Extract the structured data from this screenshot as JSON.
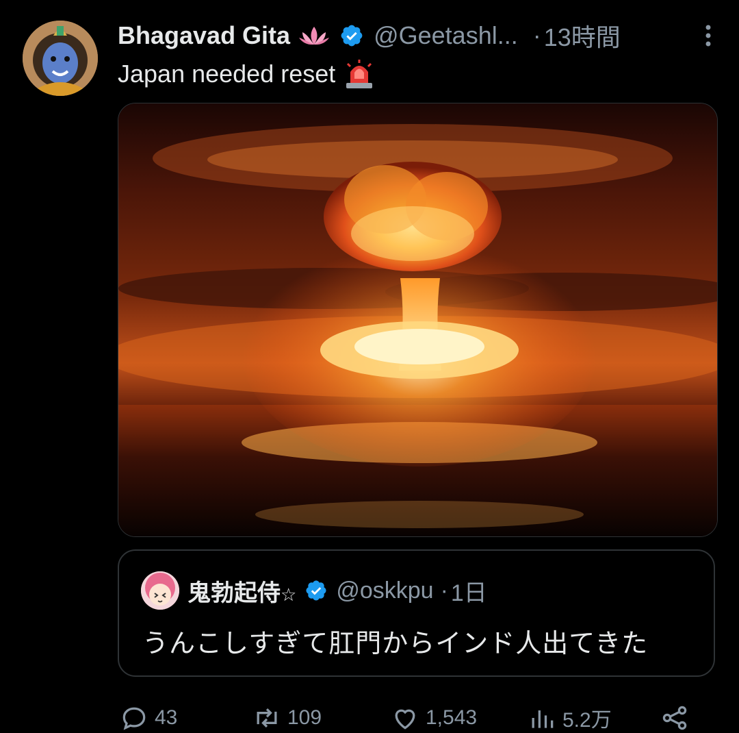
{
  "tweet": {
    "author_name": "Bhagavad Gita",
    "handle": "@Geetashl...",
    "separator": "·",
    "time": "13時間",
    "text": "Japan needed reset",
    "icons": {
      "lotus": "lotus-emoji-icon",
      "verified": "verified-badge-icon",
      "siren": "rotating-light-emoji-icon",
      "more": "more-options-icon"
    }
  },
  "quote": {
    "author_name": "鬼勃起侍",
    "star": "☆",
    "handle": "@oskkpu",
    "separator": "·",
    "time": "1日",
    "text": "うんこしすぎて肛門からインド人出てきた"
  },
  "actions": {
    "replies": "43",
    "retweets": "109",
    "likes": "1,543",
    "views": "5.2万"
  },
  "colors": {
    "background": "#000000",
    "text": "#e7e9ea",
    "secondary": "#8b98a5",
    "verified": "#1d9bf0",
    "border": "#2f3336"
  }
}
